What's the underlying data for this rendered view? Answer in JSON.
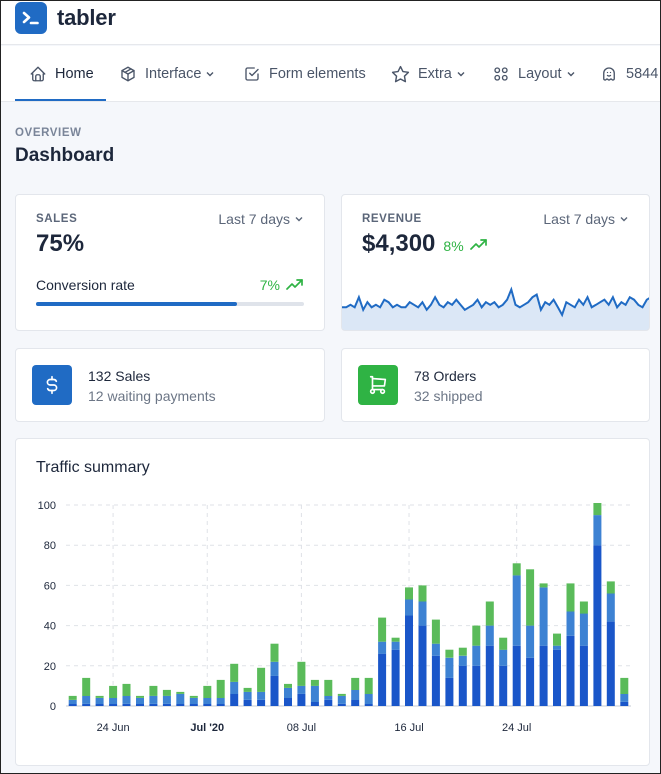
{
  "brand": {
    "name": "tabler"
  },
  "nav": {
    "items": [
      {
        "label": "Home",
        "icon": "home-icon",
        "active": true,
        "dropdown": false
      },
      {
        "label": "Interface",
        "icon": "package-icon",
        "active": false,
        "dropdown": true
      },
      {
        "label": "Form elements",
        "icon": "checkbox-icon",
        "active": false,
        "dropdown": false
      },
      {
        "label": "Extra",
        "icon": "star-icon",
        "active": false,
        "dropdown": true
      },
      {
        "label": "Layout",
        "icon": "layout-grid-icon",
        "active": false,
        "dropdown": true
      },
      {
        "label": "5844",
        "icon": "ghost-icon",
        "active": false,
        "dropdown": false
      }
    ]
  },
  "page": {
    "pretitle": "OVERVIEW",
    "title": "Dashboard"
  },
  "sales": {
    "subheader": "SALES",
    "range": "Last 7 days",
    "value": "75%",
    "label": "Conversion rate",
    "change": "7%",
    "progress": 0.75
  },
  "revenue": {
    "subheader": "REVENUE",
    "range": "Last 7 days",
    "value": "$4,300",
    "change": "8%",
    "sparkline": [
      5,
      5,
      6,
      5,
      9,
      4,
      7,
      5,
      6,
      5,
      8,
      7,
      5,
      6,
      5,
      5,
      7,
      6,
      5,
      7,
      4,
      6,
      9,
      6,
      5,
      7,
      6,
      8,
      6,
      4,
      5,
      6,
      8,
      5,
      7,
      6,
      7,
      5,
      6,
      8,
      12,
      6,
      5,
      6,
      7,
      9,
      10,
      4,
      7,
      6,
      8,
      5,
      2,
      7,
      6,
      5,
      8,
      6,
      9,
      5,
      6,
      7,
      8,
      6,
      9,
      5,
      7,
      6,
      9,
      8,
      6,
      5,
      8,
      9
    ]
  },
  "small_cards": [
    {
      "icon": "dollar-icon",
      "color": "#206bc4",
      "title": "132 Sales",
      "subtitle": "12 waiting payments"
    },
    {
      "icon": "shopping-cart-icon",
      "color": "#2fb344",
      "title": "78 Orders",
      "subtitle": "32 shipped"
    }
  ],
  "traffic": {
    "title": "Traffic summary",
    "colors": {
      "dark": "#1a56c9",
      "light": "#3d82d3",
      "green": "#5abb5a"
    },
    "chart_data": {
      "type": "bar",
      "stacked": true,
      "x_ticks": [
        {
          "label": "24 Jun",
          "index": 3,
          "bold": false
        },
        {
          "label": "Jul '20",
          "index": 10,
          "bold": true
        },
        {
          "label": "08 Jul",
          "index": 17,
          "bold": false
        },
        {
          "label": "16 Jul",
          "index": 25,
          "bold": false
        },
        {
          "label": "24 Jul",
          "index": 33,
          "bold": false
        }
      ],
      "ylim": [
        0,
        100
      ],
      "y_ticks": [
        0,
        20,
        40,
        60,
        80,
        100
      ],
      "grid": true,
      "series": [
        {
          "values": [
            1,
            1,
            1,
            1,
            1,
            1,
            1,
            1,
            1,
            1,
            1,
            1,
            6,
            3,
            3,
            15,
            4,
            6,
            2,
            3,
            1,
            3,
            1,
            26,
            28,
            45,
            40,
            25,
            14,
            20,
            20,
            30,
            20,
            30,
            24,
            30,
            28,
            35,
            30,
            80,
            42,
            2
          ]
        },
        {
          "values": [
            2,
            4,
            3,
            3,
            4,
            3,
            4,
            4,
            5,
            3,
            3,
            3,
            6,
            4,
            4,
            7,
            5,
            4,
            8,
            2,
            4,
            5,
            5,
            6,
            4,
            8,
            12,
            6,
            10,
            5,
            10,
            10,
            8,
            35,
            16,
            29,
            2,
            12,
            16,
            15,
            14,
            4
          ]
        },
        {
          "values": [
            2,
            9,
            1,
            6,
            6,
            1,
            5,
            3,
            1,
            1,
            6,
            9,
            9,
            2,
            12,
            9,
            2,
            12,
            3,
            8,
            1,
            6,
            8,
            12,
            2,
            6,
            8,
            12,
            4,
            4,
            10,
            12,
            6,
            6,
            28,
            2,
            6,
            14,
            6,
            6,
            6,
            8
          ]
        }
      ]
    }
  }
}
